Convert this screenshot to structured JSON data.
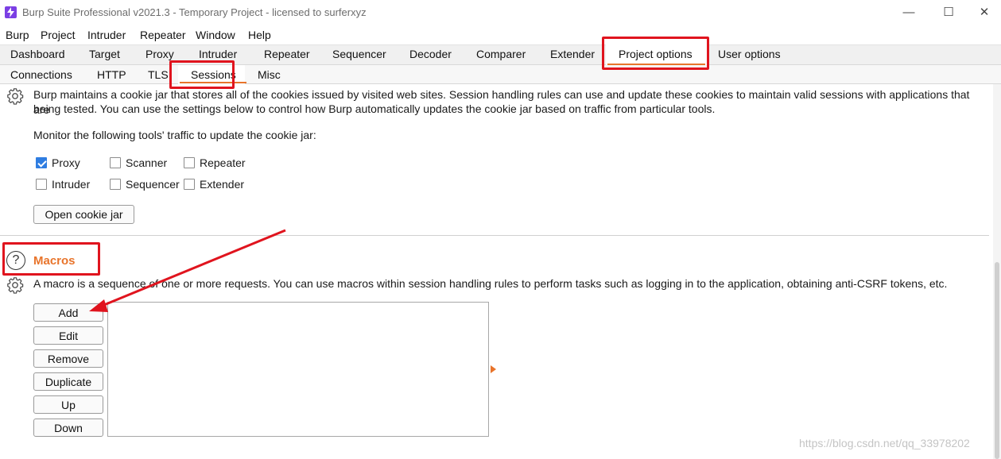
{
  "window": {
    "title": "Burp Suite Professional v2021.3 - Temporary Project - licensed to surferxyz",
    "minimize": "—",
    "maximize": "☐",
    "close": "✕"
  },
  "menu": [
    "Burp",
    "Project",
    "Intruder",
    "Repeater",
    "Window",
    "Help"
  ],
  "main_tabs": [
    "Dashboard",
    "Target",
    "Proxy",
    "Intruder",
    "Repeater",
    "Sequencer",
    "Decoder",
    "Comparer",
    "Extender",
    "Project options",
    "User options"
  ],
  "main_tabs_active": "Project options",
  "sub_tabs": [
    "Connections",
    "HTTP",
    "TLS",
    "Sessions",
    "Misc"
  ],
  "sub_tabs_active": "Sessions",
  "cookie_jar": {
    "description_line1": "Burp maintains a cookie jar that stores all of the cookies issued by visited web sites. Session handling rules can use and update these cookies to maintain valid sessions with applications that are",
    "description_line2": "being tested. You can use the settings below to control how Burp automatically updates the cookie jar based on traffic from particular tools.",
    "monitor_label": "Monitor the following tools' traffic to update the cookie jar:",
    "tools": [
      {
        "label": "Proxy",
        "checked": true
      },
      {
        "label": "Scanner",
        "checked": false
      },
      {
        "label": "Repeater",
        "checked": false
      },
      {
        "label": "Intruder",
        "checked": false
      },
      {
        "label": "Sequencer",
        "checked": false
      },
      {
        "label": "Extender",
        "checked": false
      }
    ],
    "open_button": "Open cookie jar"
  },
  "macros": {
    "title": "Macros",
    "help_symbol": "?",
    "description": "A macro is a sequence of one or more requests. You can use macros within session handling rules to perform tasks such as logging in to the application, obtaining anti-CSRF tokens, etc.",
    "buttons": [
      "Add",
      "Edit",
      "Remove",
      "Duplicate",
      "Up",
      "Down"
    ]
  },
  "icons": {
    "gear": "gear-icon",
    "help": "help-icon",
    "app": "burp-logo-icon"
  },
  "colors": {
    "accent": "#e8742b",
    "annotation_red": "#e0141e",
    "checkbox_blue": "#2f7de1"
  },
  "watermark": "https://blog.csdn.net/qq_33978202"
}
